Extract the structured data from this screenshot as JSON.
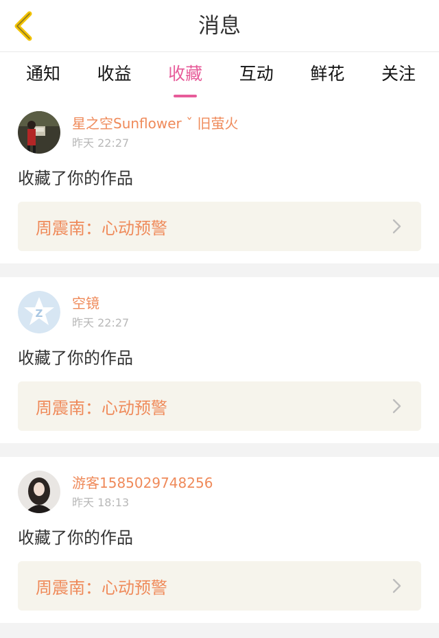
{
  "header": {
    "title": "消息",
    "back_icon": "chevron-left-icon",
    "back_color": "#f2c200"
  },
  "tabs": [
    {
      "label": "通知",
      "active": false
    },
    {
      "label": "收益",
      "active": false
    },
    {
      "label": "收藏",
      "active": true
    },
    {
      "label": "互动",
      "active": false
    },
    {
      "label": "鲜花",
      "active": false
    },
    {
      "label": "关注",
      "active": false
    }
  ],
  "colors": {
    "accent": "#e75c9a",
    "username": "#ef8a5a",
    "work_bg": "#f6f4ec"
  },
  "items": [
    {
      "user": "星之空Sunflower ˇ 旧萤火",
      "time": "昨天 22:27",
      "action": "收藏了你的作品",
      "work": "周震南：心动预警",
      "avatar": "user-photo-avatar"
    },
    {
      "user": "空镜",
      "time": "昨天 22:27",
      "action": "收藏了你的作品",
      "work": "周震南：心动预警",
      "avatar": "default-star-avatar"
    },
    {
      "user": "游客1585029748256",
      "time": "昨天 18:13",
      "action": "收藏了你的作品",
      "work": "周震南：心动预警",
      "avatar": "user-photo-avatar"
    }
  ]
}
